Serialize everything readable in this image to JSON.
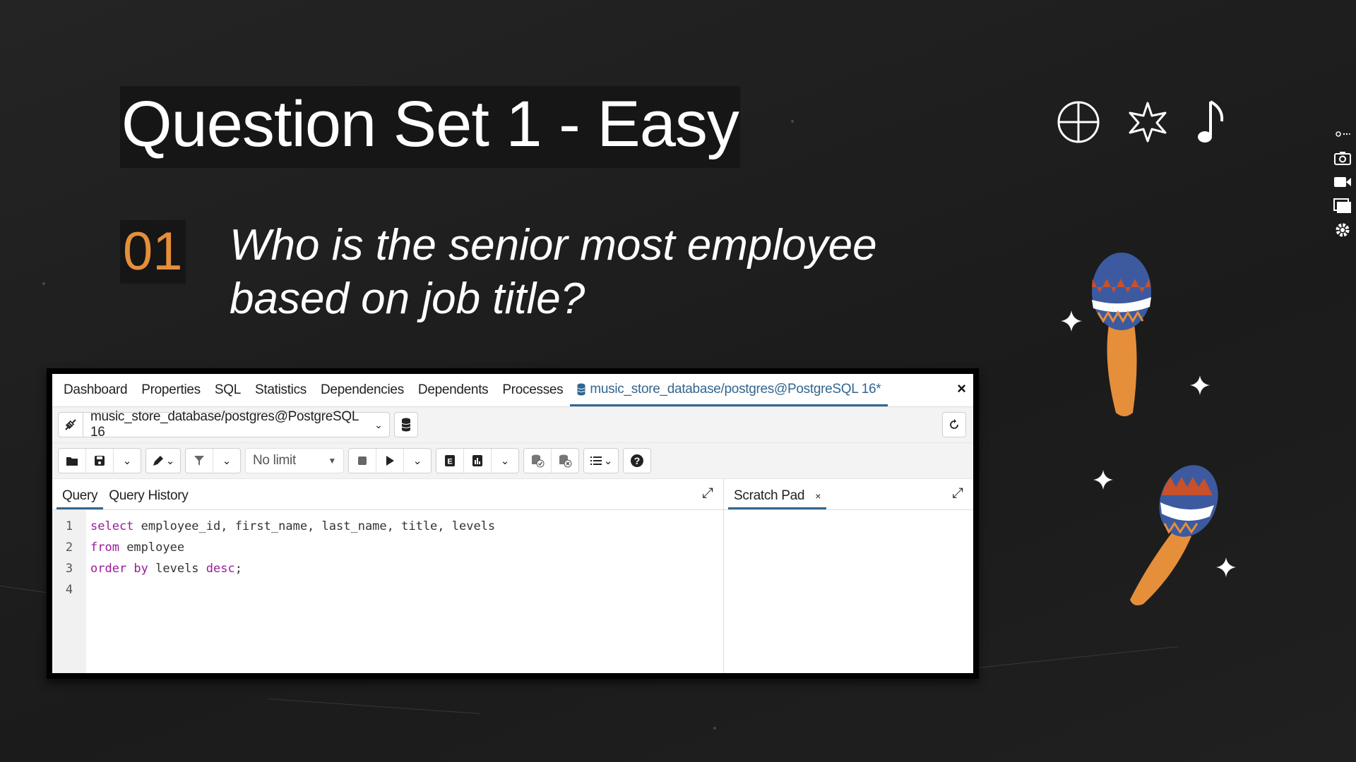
{
  "slide": {
    "title": "Question Set 1 - Easy",
    "question_number": "01",
    "question_line1": "Who is the senior most employee",
    "question_line2": "based on job title?"
  },
  "colors": {
    "accent_orange": "#e58f3a",
    "pg_blue": "#326690",
    "keyword_purple": "#9b1a9b"
  },
  "app": {
    "tabs": [
      "Dashboard",
      "Properties",
      "SQL",
      "Statistics",
      "Dependencies",
      "Dependents",
      "Processes"
    ],
    "active_tab": "music_store_database/postgres@PostgreSQL 16*",
    "close_label": "×",
    "connection": "music_store_database/postgres@PostgreSQL 16",
    "limit_label": "No limit",
    "left_tabs": [
      "Query",
      "Query History"
    ],
    "right_tab": "Scratch Pad",
    "right_tab_close": "×",
    "lines": [
      "1",
      "2",
      "3",
      "4"
    ],
    "code": {
      "l1_kw": "select",
      "l1_rest": " employee_id, first_name, last_name, title, levels",
      "l2_kw": "from",
      "l2_rest": " employee",
      "l3_kw1": "order by",
      "l3_mid": " levels ",
      "l3_kw2": "desc",
      "l3_end": ";"
    }
  },
  "icons": [
    "globe-icon",
    "star-icon",
    "music-note-icon",
    "maraca-icon",
    "sparkle-icon",
    "camera-icon",
    "video-icon",
    "window-icon",
    "gear-icon"
  ]
}
